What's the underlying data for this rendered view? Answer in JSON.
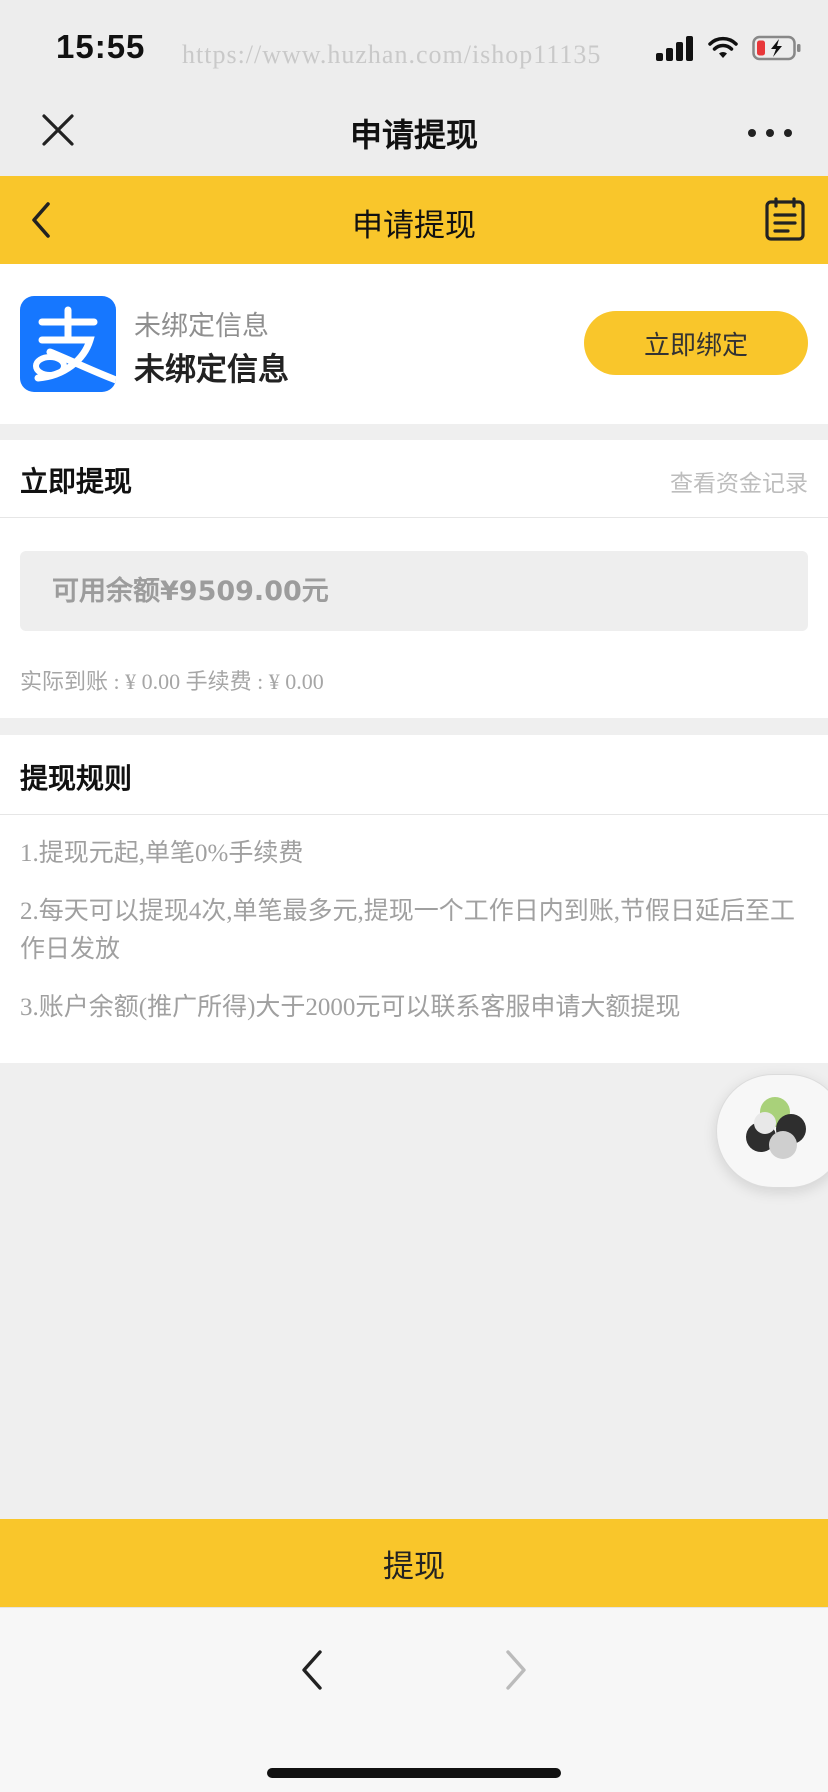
{
  "status_bar": {
    "time": "15:55",
    "watermark": "https://www.huzhan.com/ishop11135",
    "icons": [
      "signal-icon",
      "wifi-icon",
      "battery-charging-icon"
    ]
  },
  "wechat_nav": {
    "title": "申请提现",
    "icons": [
      "close-icon",
      "more-icon"
    ]
  },
  "header": {
    "title": "申请提现",
    "icons": [
      "back-icon",
      "record-list-icon"
    ]
  },
  "bind": {
    "sub_label": "未绑定信息",
    "main_label": "未绑定信息",
    "button_label": "立即绑定",
    "logo_icon": "alipay-icon"
  },
  "withdraw": {
    "title": "立即提现",
    "record_link": "查看资金记录",
    "amount_placeholder": "可用余额¥9509.00元",
    "fee_line": "实际到账 : ¥ 0.00 手续费 : ¥ 0.00"
  },
  "rules": {
    "title": "提现规则",
    "items": [
      "1.提现元起,单笔0%手续费",
      "2.每天可以提现4次,单笔最多元,提现一个工作日内到账,节假日延后至工作日发放",
      "3.账户余额(推广所得)大于2000元可以联系客服申请大额提现"
    ]
  },
  "submit": {
    "label": "提现"
  },
  "browser_bar": {
    "icons": [
      "nav-back-icon",
      "nav-forward-icon"
    ]
  },
  "colors": {
    "accent": "#f9c62b",
    "alipay": "#1677ff",
    "background": "#efefef"
  }
}
